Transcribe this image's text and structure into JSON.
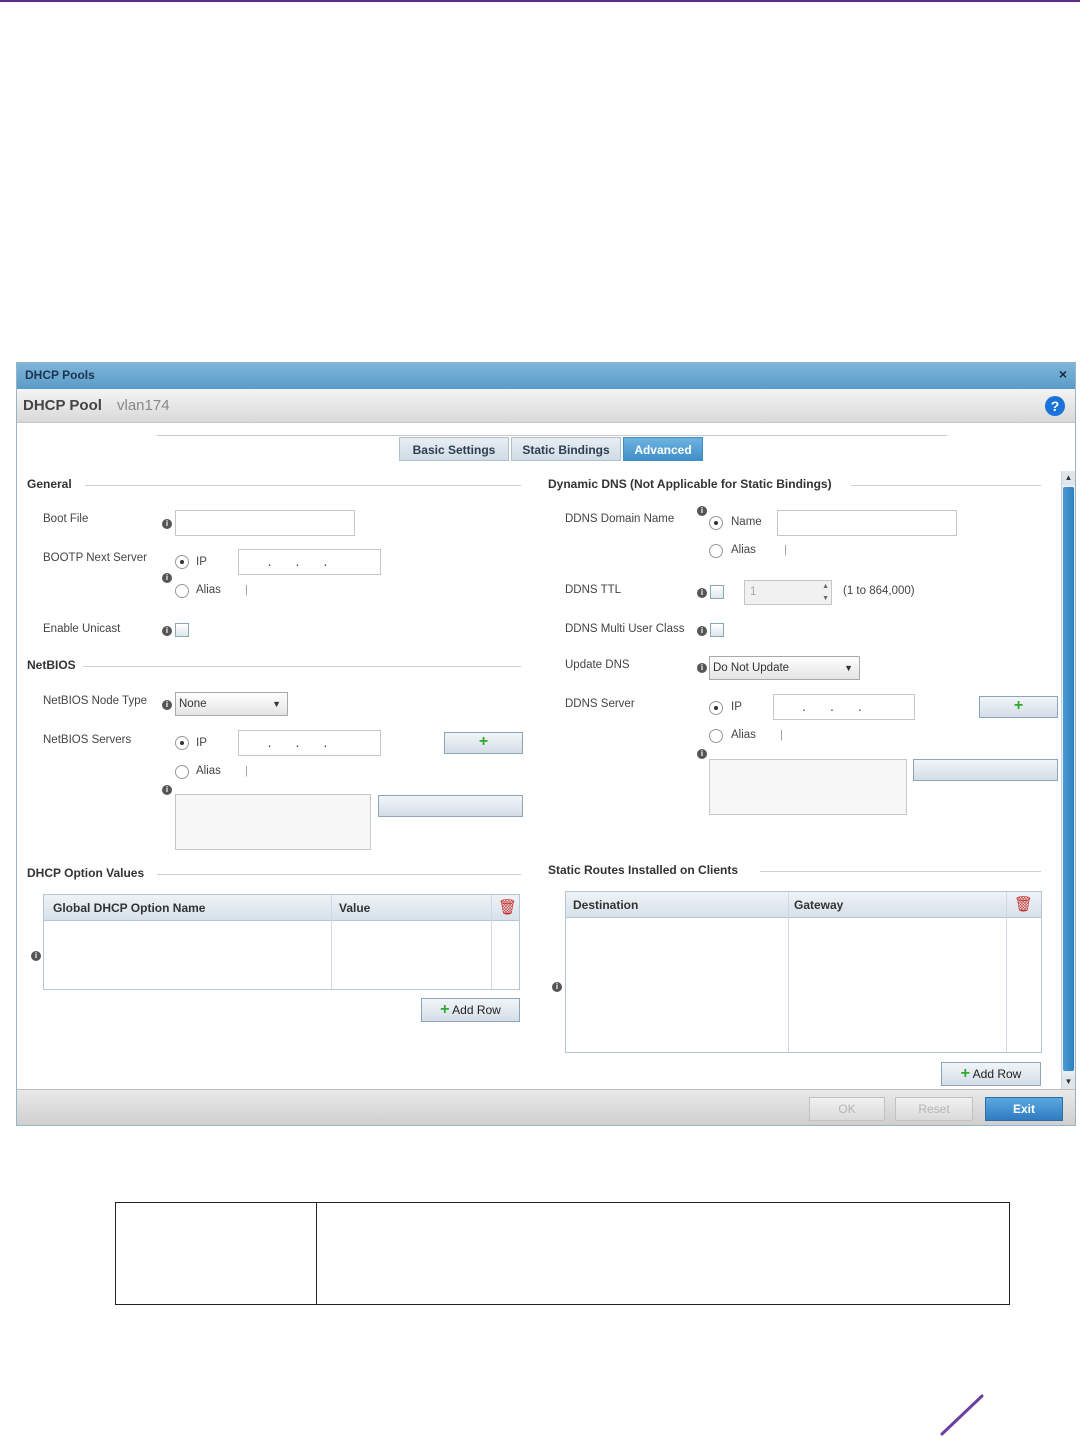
{
  "dialog": {
    "title": "DHCP Pools",
    "close_glyph": "×",
    "header_label": "DHCP Pool",
    "pool_name": "vlan174",
    "help_glyph": "?"
  },
  "tabs": [
    {
      "label": "Basic Settings",
      "active": false
    },
    {
      "label": "Static Bindings",
      "active": false
    },
    {
      "label": "Advanced",
      "active": true
    }
  ],
  "general": {
    "section_title": "General",
    "boot_file_label": "Boot File",
    "boot_file_value": "",
    "bootp_next_server_label": "BOOTP Next Server",
    "ip_label": "IP",
    "alias_label": "Alias",
    "alias_sep": "|",
    "ip_dots": "...",
    "enable_unicast_label": "Enable Unicast"
  },
  "netbios": {
    "section_title": "NetBIOS",
    "node_type_label": "NetBIOS Node Type",
    "node_type_value": "None",
    "servers_label": "NetBIOS Servers",
    "ip_label": "IP",
    "alias_label": "Alias",
    "alias_sep": "|",
    "ip_dots": "..."
  },
  "dhcp_options": {
    "section_title": "DHCP Option Values",
    "columns": [
      "Global DHCP Option Name",
      "Value"
    ],
    "add_row_label": "Add Row"
  },
  "ddns": {
    "section_title": "Dynamic DNS (Not Applicable for Static Bindings)",
    "domain_name_label": "DDNS Domain Name",
    "name_label": "Name",
    "alias_label": "Alias",
    "alias_sep": "|",
    "ttl_label": "DDNS TTL",
    "ttl_value": "1",
    "ttl_range": "(1 to 864,000)",
    "multi_user_class_label": "DDNS Multi User Class",
    "update_dns_label": "Update DNS",
    "update_dns_value": "Do Not Update",
    "server_label": "DDNS Server",
    "ip_label": "IP",
    "ip_dots": "..."
  },
  "static_routes": {
    "section_title": "Static Routes Installed on Clients",
    "columns": [
      "Destination",
      "Gateway"
    ],
    "add_row_label": "Add Row"
  },
  "footer": {
    "ok_label": "OK",
    "reset_label": "Reset",
    "exit_label": "Exit"
  },
  "icons": {
    "info": "i",
    "trash": "🗑",
    "plus": "+",
    "dropdown": "▼",
    "spin_up": "▲",
    "spin_down": "▼"
  }
}
